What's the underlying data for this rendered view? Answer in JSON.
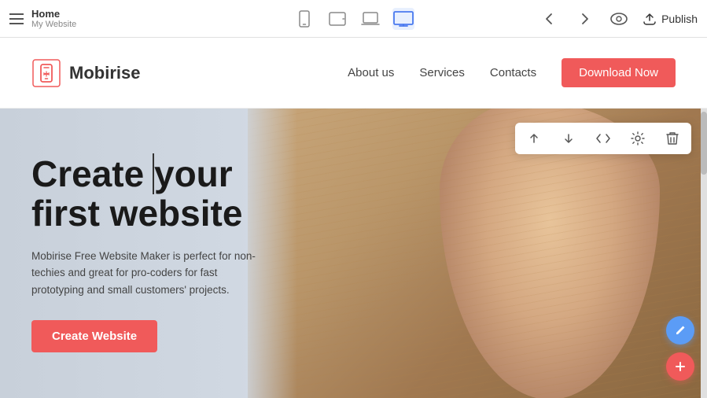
{
  "toolbar": {
    "hamburger_label": "menu",
    "page_title": "Home",
    "page_subtitle": "My Website",
    "devices": [
      {
        "id": "mobile",
        "label": "Mobile"
      },
      {
        "id": "tablet",
        "label": "Tablet"
      },
      {
        "id": "laptop",
        "label": "Laptop"
      },
      {
        "id": "desktop",
        "label": "Desktop",
        "active": true
      }
    ],
    "back_label": "Back",
    "forward_label": "Forward",
    "preview_label": "Preview",
    "publish_label": "Publish",
    "publish_icon": "cloud-upload"
  },
  "site_header": {
    "logo_text": "Mobirise",
    "nav_links": [
      "About us",
      "Services",
      "Contacts"
    ],
    "download_btn": "Download Now"
  },
  "hero": {
    "heading_line1": "Create your",
    "heading_line2": "first website",
    "description": "Mobirise Free Website Maker is perfect for non-techies and great for pro-coders for fast prototyping and small customers' projects.",
    "cta_button": "Create Website"
  },
  "float_toolbar": {
    "up_icon": "arrow-up",
    "down_icon": "arrow-down",
    "code_icon": "code",
    "settings_icon": "gear",
    "delete_icon": "trash"
  },
  "fab": {
    "edit_icon": "pencil",
    "add_icon": "plus"
  }
}
